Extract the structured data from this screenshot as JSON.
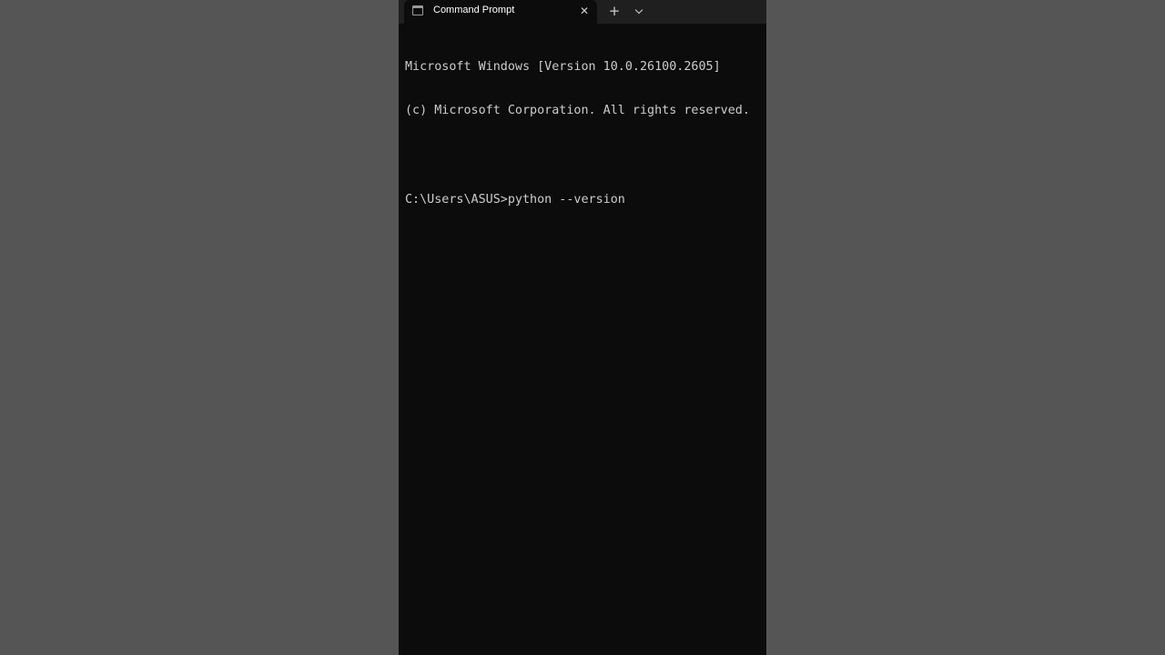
{
  "window": {
    "tab": {
      "title": "Command Prompt",
      "close_glyph": "✕",
      "icon": "terminal-icon"
    },
    "new_tab_glyph": "+",
    "dropdown_icon": "chevron-down-icon"
  },
  "console": {
    "lines": [
      "Microsoft Windows [Version 10.0.26100.2605]",
      "(c) Microsoft Corporation. All rights reserved.",
      "",
      "C:\\Users\\ASUS>python --version"
    ]
  },
  "colors": {
    "backdrop": "#555555",
    "terminal_bg": "#0c0c0c",
    "tab_bar_bg": "#1f1f1f",
    "text": "#cccccc"
  }
}
